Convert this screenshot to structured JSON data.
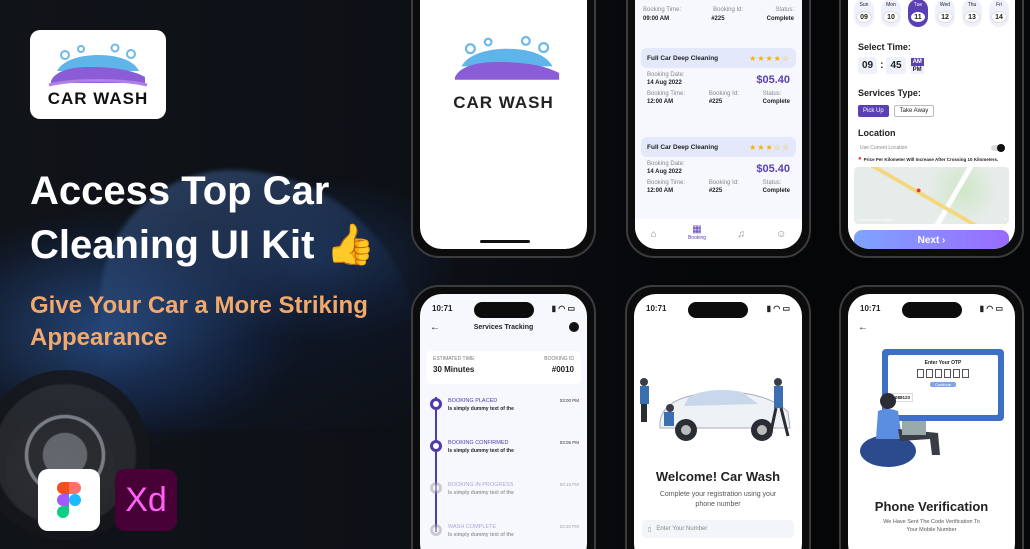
{
  "brand": {
    "name": "CAR WASH"
  },
  "hero": {
    "headline": "Access Top Car Cleaning UI Kit 👍",
    "subline": "Give Your Car a More Striking Appearance"
  },
  "tools": {
    "xd": "Xd"
  },
  "colors": {
    "accent": "#5b3fb5",
    "subline": "#f2a96b",
    "xd_bg": "#470137"
  },
  "bookings": {
    "top_row": {
      "time_label": "Booking Time:",
      "id_label": "Booking Id:",
      "status_label": "Status:",
      "time": "09:00 AM",
      "id": "#225",
      "status": "Complete"
    },
    "items": [
      {
        "title": "Full Car Deep Cleaning",
        "stars": "★★★★☆",
        "date_label": "Booking Date:",
        "date": "14 Aug 2022",
        "price": "$05.40",
        "time_label": "Booking Time:",
        "time": "12:00 AM",
        "id_label": "Booking Id:",
        "id": "#225",
        "status_label": "Status:",
        "status": "Complete"
      },
      {
        "title": "Full Car Deep Cleaning",
        "stars": "★★★☆☆",
        "date_label": "Booking Date:",
        "date": "14 Aug 2022",
        "price": "$05.40",
        "time_label": "Booking Time:",
        "time": "12:00 AM",
        "id_label": "Booking Id:",
        "id": "#225",
        "status_label": "Status:",
        "status": "Complete"
      }
    ],
    "nav_active": "Booking"
  },
  "schedule": {
    "days": [
      {
        "d": "Sun",
        "n": "09"
      },
      {
        "d": "Mon",
        "n": "10"
      },
      {
        "d": "Tue",
        "n": "11"
      },
      {
        "d": "Wed",
        "n": "12"
      },
      {
        "d": "Thu",
        "n": "13"
      },
      {
        "d": "Fri",
        "n": "14"
      }
    ],
    "select_time": "Select Time:",
    "hour": "09",
    "sep": ":",
    "minute": "45",
    "am": "AM",
    "pm": "PM",
    "services_type": "Services Type:",
    "pickup": "Pick Up",
    "takeaway": "Take Away",
    "location": "Location",
    "use_current": "Use Current Location",
    "warning": "Price Per Kilometer Will Increase After Crossing 10 Kilometers.",
    "map_caption": "Central station gate 4",
    "next": "Next"
  },
  "tracking": {
    "time": "10:71",
    "title": "Services Tracking",
    "est_label": "ESTIMATED TIME",
    "est_value": "30 Minutes",
    "id_label": "BOOKING ID",
    "id_value": "#0010",
    "steps": [
      {
        "title": "BOOKING PLACED",
        "desc": "Is simply dummy text of the",
        "time": "03:00 PM"
      },
      {
        "title": "BOOKING CONFIRMED",
        "desc": "Is simply dummy text of the",
        "time": "03:05 PM"
      },
      {
        "title": "BOOKING IN PROGRESS",
        "desc": "Is simply dummy text of the",
        "time": "03:15 PM"
      },
      {
        "title": "WASH COMPLETE",
        "desc": "Is simply dummy text of the",
        "time": "03:20 PM"
      }
    ]
  },
  "welcome": {
    "time": "10:71",
    "title": "Welcome! Car Wash",
    "desc": "Complete your registration using your phone number",
    "placeholder": "Enter Your Number"
  },
  "verify": {
    "time": "10:71",
    "otp_title": "Enter Your OTP",
    "otp_msg": "088123",
    "otp_btn": "Continue",
    "title": "Phone Verification",
    "desc": "We Have Sent The Code Verification To Your Mobile Number"
  }
}
